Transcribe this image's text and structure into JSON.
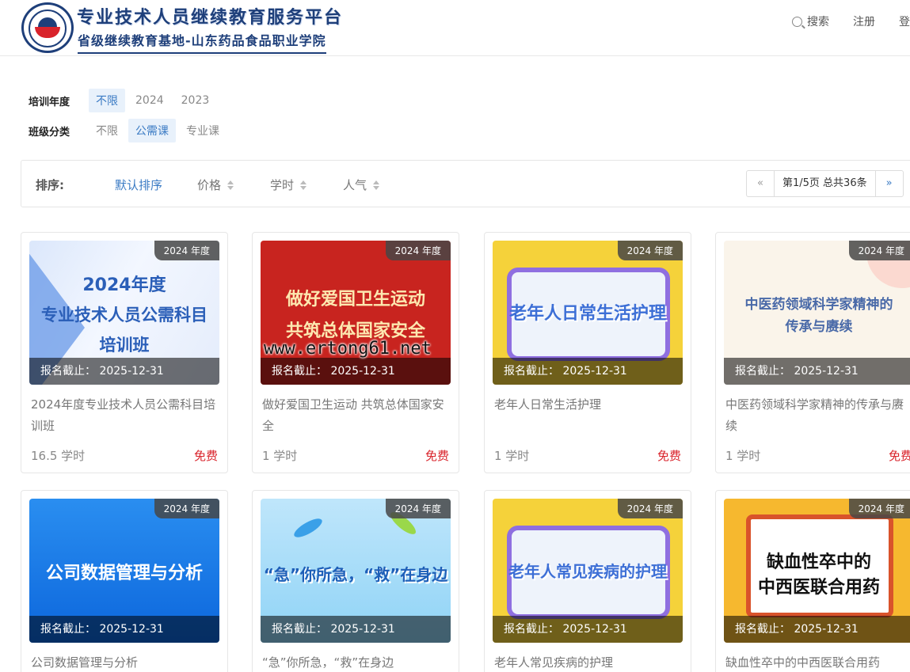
{
  "header": {
    "title": "专业技术人员继续教育服务平台",
    "subtitle": "省级继续教育基地-山东药品食品职业学院",
    "nav": {
      "search_label": "搜索",
      "register_label": "注册",
      "login_label": "登"
    }
  },
  "filters": {
    "year": {
      "label": "培训年度",
      "options": [
        "不限",
        "2024",
        "2023"
      ],
      "selected": "不限"
    },
    "category": {
      "label": "班级分类",
      "options": [
        "不限",
        "公需课",
        "专业课"
      ],
      "selected": "公需课"
    }
  },
  "sortbar": {
    "label": "排序:",
    "items": [
      "默认排序",
      "价格",
      "学时",
      "人气"
    ],
    "active": "默认排序",
    "pager": {
      "prev": "«",
      "info": "第1/5页 总共36条",
      "next": "»"
    }
  },
  "courses": [
    {
      "year_badge": "2024 年度",
      "deadline": "报名截止： 2025-12-31",
      "title": "2024年度专业技术人员公需科目培训班",
      "hours": "16.5 学时",
      "price": "免费",
      "thumb_text": [
        "2024年度",
        "专业技术人员公需科目",
        "培训班"
      ]
    },
    {
      "year_badge": "2024 年度",
      "deadline": "报名截止： 2025-12-31",
      "title": "做好爱国卫生运动 共筑总体国家安全",
      "hours": "1 学时",
      "price": "免费",
      "thumb_text": [
        "做好爱国卫生运动",
        "共筑总体国家安全"
      ]
    },
    {
      "year_badge": "2024 年度",
      "deadline": "报名截止： 2025-12-31",
      "title": "老年人日常生活护理",
      "hours": "1 学时",
      "price": "免费",
      "thumb_text": [
        "老年人日常生活护理"
      ]
    },
    {
      "year_badge": "2024 年度",
      "deadline": "报名截止： 2025-12-31",
      "title": "中医药领域科学家精神的传承与赓续",
      "hours": "1 学时",
      "price": "免费",
      "thumb_text": [
        "中医药领域科学家精神的",
        "传承与赓续"
      ]
    },
    {
      "year_badge": "2024 年度",
      "deadline": "报名截止： 2025-12-31",
      "title": "公司数据管理与分析",
      "thumb_text": [
        "公司数据管理与分析"
      ]
    },
    {
      "year_badge": "2024 年度",
      "deadline": "报名截止： 2025-12-31",
      "title": "“急”你所急，“救”在身边",
      "thumb_text": [
        "“急”你所急，“救”在身边"
      ]
    },
    {
      "year_badge": "2024 年度",
      "deadline": "报名截止： 2025-12-31",
      "title": "老年人常见疾病的护理",
      "thumb_text": [
        "老年人常见疾病的护理"
      ]
    },
    {
      "year_badge": "2024 年度",
      "deadline": "报名截止： 2025-12-31",
      "title": "缺血性卒中的中西医联合用药",
      "thumb_text": [
        "缺血性卒中的",
        "中西医联合用药"
      ]
    }
  ],
  "watermark": "www.ertong61.net",
  "colors": {
    "accent": "#3b7bc4",
    "price": "#d9232b",
    "brand": "#1e3f7a"
  }
}
